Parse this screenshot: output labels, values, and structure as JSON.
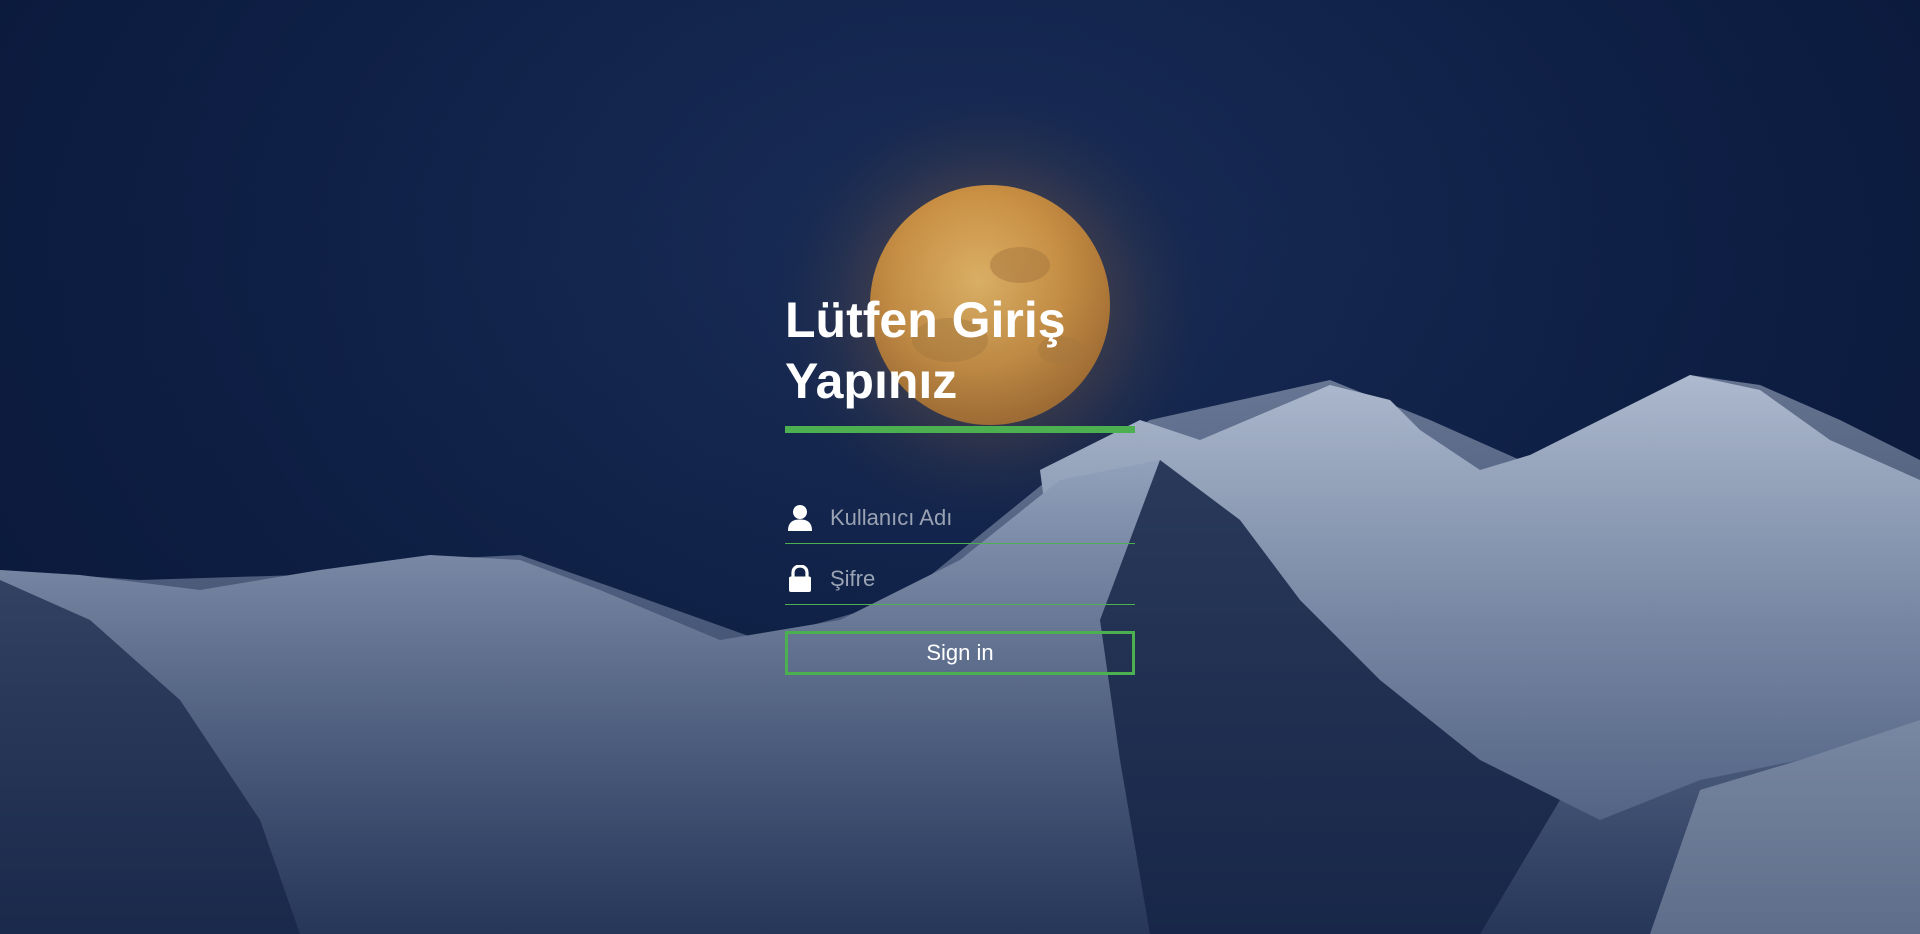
{
  "login": {
    "title": "Lütfen Giriş Yapınız",
    "username_placeholder": "Kullanıcı Adı",
    "password_placeholder": "Şifre",
    "signin_label": "Sign in",
    "username_icon": "user-icon",
    "password_icon": "lock-icon"
  },
  "theme": {
    "accent": "#4caf50",
    "background": "#0e1f45",
    "text": "#ffffff"
  }
}
